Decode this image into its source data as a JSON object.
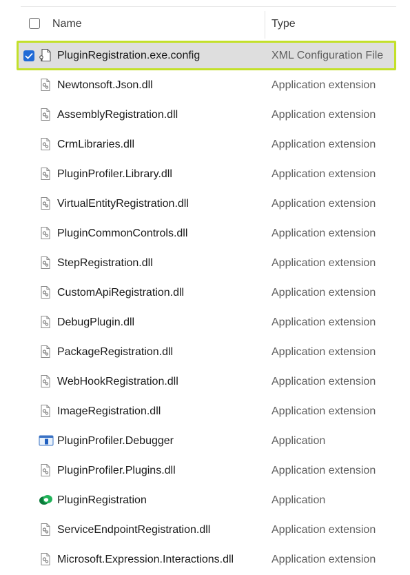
{
  "header": {
    "name_label": "Name",
    "type_label": "Type"
  },
  "rows": [
    {
      "name": "PluginRegistration.exe.config",
      "type": "XML Configuration File",
      "icon": "config-file-icon",
      "selected": true
    },
    {
      "name": "Newtonsoft.Json.dll",
      "type": "Application extension",
      "icon": "dll-file-icon"
    },
    {
      "name": "AssemblyRegistration.dll",
      "type": "Application extension",
      "icon": "dll-file-icon"
    },
    {
      "name": "CrmLibraries.dll",
      "type": "Application extension",
      "icon": "dll-file-icon"
    },
    {
      "name": "PluginProfiler.Library.dll",
      "type": "Application extension",
      "icon": "dll-file-icon"
    },
    {
      "name": "VirtualEntityRegistration.dll",
      "type": "Application extension",
      "icon": "dll-file-icon"
    },
    {
      "name": "PluginCommonControls.dll",
      "type": "Application extension",
      "icon": "dll-file-icon"
    },
    {
      "name": "StepRegistration.dll",
      "type": "Application extension",
      "icon": "dll-file-icon"
    },
    {
      "name": "CustomApiRegistration.dll",
      "type": "Application extension",
      "icon": "dll-file-icon"
    },
    {
      "name": "DebugPlugin.dll",
      "type": "Application extension",
      "icon": "dll-file-icon"
    },
    {
      "name": "PackageRegistration.dll",
      "type": "Application extension",
      "icon": "dll-file-icon"
    },
    {
      "name": "WebHookRegistration.dll",
      "type": "Application extension",
      "icon": "dll-file-icon"
    },
    {
      "name": "ImageRegistration.dll",
      "type": "Application extension",
      "icon": "dll-file-icon"
    },
    {
      "name": "PluginProfiler.Debugger",
      "type": "Application",
      "icon": "app-window-icon"
    },
    {
      "name": "PluginProfiler.Plugins.dll",
      "type": "Application extension",
      "icon": "dll-file-icon"
    },
    {
      "name": "PluginRegistration",
      "type": "Application",
      "icon": "dataverse-logo-icon"
    },
    {
      "name": "ServiceEndpointRegistration.dll",
      "type": "Application extension",
      "icon": "dll-file-icon"
    },
    {
      "name": "Microsoft.Expression.Interactions.dll",
      "type": "Application extension",
      "icon": "dll-file-icon"
    }
  ],
  "colors": {
    "selection_border": "#c3e02a",
    "selection_bg": "#dedede",
    "checkbox_blue": "#1f6ad6"
  }
}
